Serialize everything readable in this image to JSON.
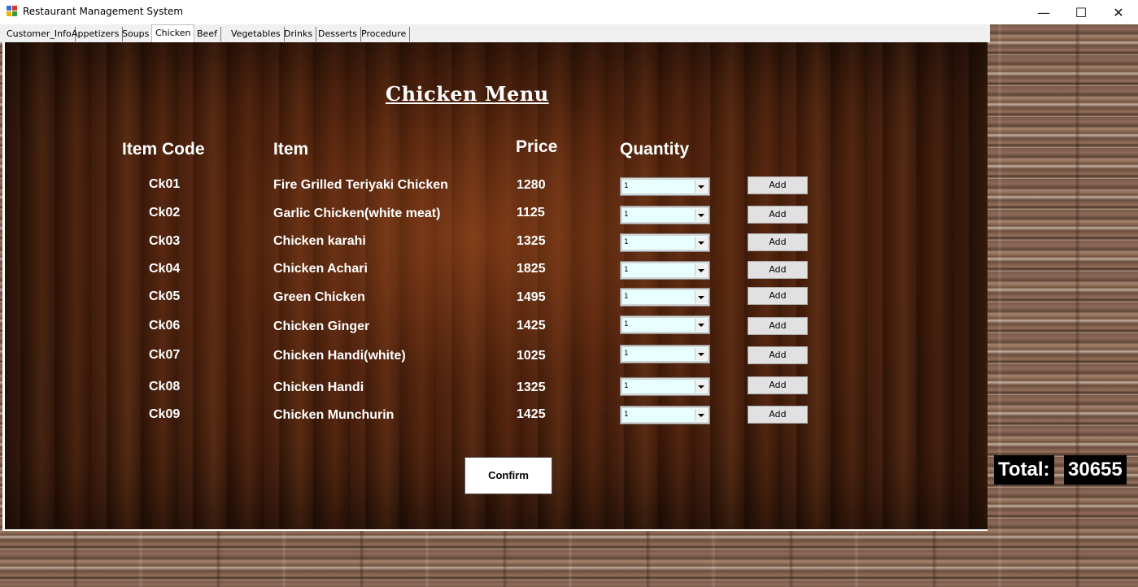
{
  "window": {
    "title": "Restaurant Management System",
    "minimize_glyph": "—",
    "maximize_glyph": "☐",
    "close_glyph": "✕"
  },
  "tabs": [
    {
      "label": "Customer_Info",
      "active": false
    },
    {
      "label": "Appetizers",
      "active": false
    },
    {
      "label": "Soups",
      "active": false
    },
    {
      "label": "Chicken",
      "active": true
    },
    {
      "label": "Beef",
      "active": false
    },
    {
      "label": "Vegetables",
      "active": false
    },
    {
      "label": "Drinks",
      "active": false
    },
    {
      "label": "Desserts",
      "active": false
    },
    {
      "label": "Procedure",
      "active": false
    }
  ],
  "menu": {
    "title": "Chicken Menu",
    "headers": {
      "code": "Item Code",
      "item": "Item",
      "price": "Price",
      "quantity": "Quantity"
    },
    "items": [
      {
        "code": "Ck01",
        "name": "Fire Grilled Teriyaki Chicken",
        "price": "1280",
        "qty": "1",
        "add_label": "Add"
      },
      {
        "code": "Ck02",
        "name": "Garlic Chicken(white meat)",
        "price": "1125",
        "qty": "1",
        "add_label": "Add"
      },
      {
        "code": "Ck03",
        "name": "Chicken karahi",
        "price": "1325",
        "qty": "1",
        "add_label": "Add"
      },
      {
        "code": "Ck04",
        "name": "Chicken Achari",
        "price": "1825",
        "qty": "1",
        "add_label": "Add"
      },
      {
        "code": "Ck05",
        "name": "Green Chicken",
        "price": "1495",
        "qty": "1",
        "add_label": "Add"
      },
      {
        "code": "Ck06",
        "name": "Chicken Ginger",
        "price": "1425",
        "qty": "1",
        "add_label": "Add"
      },
      {
        "code": "Ck07",
        "name": "Chicken Handi(white)",
        "price": "1025",
        "qty": "1",
        "add_label": "Add"
      },
      {
        "code": "Ck08",
        "name": "Chicken Handi",
        "price": "1325",
        "qty": "1",
        "add_label": "Add"
      },
      {
        "code": "Ck09",
        "name": "Chicken Munchurin",
        "price": "1425",
        "qty": "1",
        "add_label": "Add"
      }
    ],
    "confirm_label": "Confirm"
  },
  "total": {
    "label": "Total:",
    "value": "30655"
  }
}
